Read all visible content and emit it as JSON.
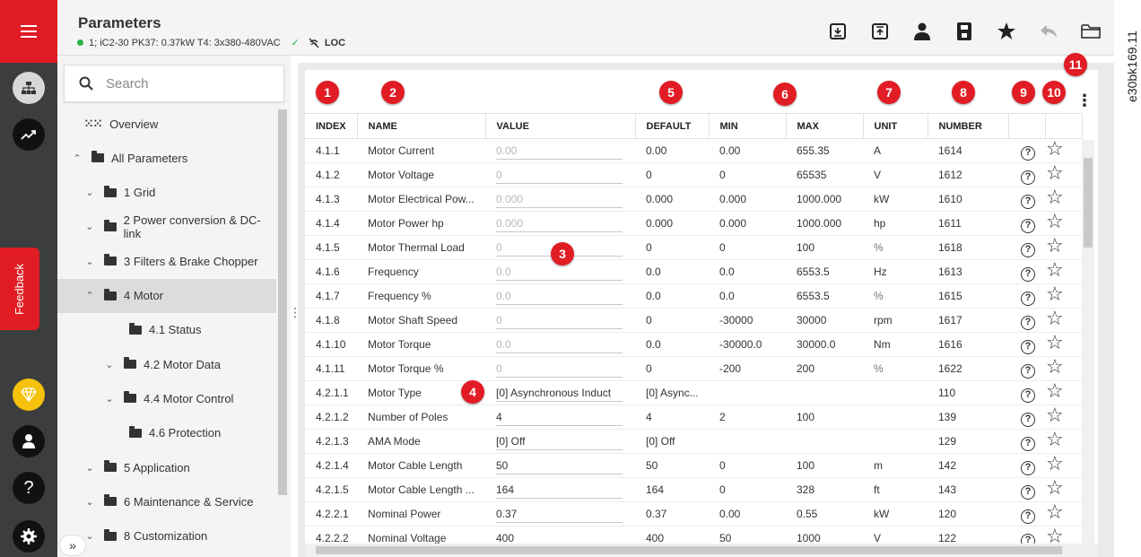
{
  "header": {
    "title": "Parameters",
    "status_text": "1; iC2-30 PK37: 0.37kW T4: 3x380-480VAC",
    "mode": "LOC"
  },
  "side_tag": "e30bk169.11",
  "rail": {
    "feedback_label": "Feedback",
    "help_glyph": "?"
  },
  "search": {
    "placeholder": "Search"
  },
  "tree": [
    {
      "label": "Overview",
      "chev": "",
      "indent": 0,
      "icon": "grid"
    },
    {
      "label": "All Parameters",
      "chev": "^",
      "indent": 0,
      "icon": "folder"
    },
    {
      "label": "1 Grid",
      "chev": "v",
      "indent": 1,
      "icon": "folder"
    },
    {
      "label": "2 Power conversion & DC-link",
      "chev": "v",
      "indent": 1,
      "icon": "folder"
    },
    {
      "label": "3 Filters & Brake Chopper",
      "chev": "v",
      "indent": 1,
      "icon": "folder"
    },
    {
      "label": "4 Motor",
      "chev": "^",
      "indent": 1,
      "icon": "folder",
      "active": true
    },
    {
      "label": "4.1 Status",
      "chev": "",
      "indent": 2,
      "icon": "folder"
    },
    {
      "label": "4.2 Motor Data",
      "chev": "v",
      "indent": 2,
      "icon": "folder"
    },
    {
      "label": "4.4 Motor Control",
      "chev": "v",
      "indent": 2,
      "icon": "folder"
    },
    {
      "label": "4.6 Protection",
      "chev": "",
      "indent": 2,
      "icon": "folder"
    },
    {
      "label": "5 Application",
      "chev": "v",
      "indent": 1,
      "icon": "folder"
    },
    {
      "label": "6 Maintenance & Service",
      "chev": "v",
      "indent": 1,
      "icon": "folder"
    },
    {
      "label": "8 Customization",
      "chev": "v",
      "indent": 1,
      "icon": "folder"
    }
  ],
  "columns": [
    "INDEX",
    "NAME",
    "VALUE",
    "DEFAULT",
    "MIN",
    "MAX",
    "UNIT",
    "NUMBER"
  ],
  "rows": [
    {
      "index": "4.1.1",
      "name": "Motor Current",
      "value": "0.00",
      "readonly": true,
      "default": "0.00",
      "min": "0.00",
      "max": "655.35",
      "unit": "A",
      "number": "1614"
    },
    {
      "index": "4.1.2",
      "name": "Motor Voltage",
      "value": "0",
      "readonly": true,
      "default": "0",
      "min": "0",
      "max": "65535",
      "unit": "V",
      "number": "1612"
    },
    {
      "index": "4.1.3",
      "name": "Motor Electrical Pow...",
      "value": "0.000",
      "readonly": true,
      "default": "0.000",
      "min": "0.000",
      "max": "1000.000",
      "unit": "kW",
      "number": "1610"
    },
    {
      "index": "4.1.4",
      "name": "Motor Power hp",
      "value": "0.000",
      "readonly": true,
      "default": "0.000",
      "min": "0.000",
      "max": "1000.000",
      "unit": "hp",
      "number": "1611"
    },
    {
      "index": "4.1.5",
      "name": "Motor Thermal Load",
      "value": "0",
      "readonly": true,
      "default": "0",
      "min": "0",
      "max": "100",
      "unit": "%",
      "number": "1618"
    },
    {
      "index": "4.1.6",
      "name": "Frequency",
      "value": "0.0",
      "readonly": true,
      "default": "0.0",
      "min": "0.0",
      "max": "6553.5",
      "unit": "Hz",
      "number": "1613"
    },
    {
      "index": "4.1.7",
      "name": "Frequency %",
      "value": "0.0",
      "readonly": true,
      "default": "0.0",
      "min": "0.0",
      "max": "6553.5",
      "unit": "%",
      "number": "1615"
    },
    {
      "index": "4.1.8",
      "name": "Motor Shaft Speed",
      "value": "0",
      "readonly": true,
      "default": "0",
      "min": "-30000",
      "max": "30000",
      "unit": "rpm",
      "number": "1617"
    },
    {
      "index": "4.1.10",
      "name": "Motor Torque",
      "value": "0.0",
      "readonly": true,
      "default": "0.0",
      "min": "-30000.0",
      "max": "30000.0",
      "unit": "Nm",
      "number": "1616"
    },
    {
      "index": "4.1.11",
      "name": "Motor Torque %",
      "value": "0",
      "readonly": true,
      "default": "0",
      "min": "-200",
      "max": "200",
      "unit": "%",
      "number": "1622"
    },
    {
      "index": "4.2.1.1",
      "name": "Motor Type",
      "value": "[0] Asynchronous Induct",
      "readonly": false,
      "default": "[0] Async...",
      "min": "",
      "max": "",
      "unit": "",
      "number": "110"
    },
    {
      "index": "4.2.1.2",
      "name": "Number of Poles",
      "value": "4",
      "readonly": false,
      "default": "4",
      "min": "2",
      "max": "100",
      "unit": "",
      "number": "139"
    },
    {
      "index": "4.2.1.3",
      "name": "AMA Mode",
      "value": "[0] Off",
      "readonly": false,
      "default": "[0] Off",
      "min": "",
      "max": "",
      "unit": "",
      "number": "129"
    },
    {
      "index": "4.2.1.4",
      "name": "Motor Cable Length",
      "value": "50",
      "readonly": false,
      "default": "50",
      "min": "0",
      "max": "100",
      "unit": "m",
      "number": "142"
    },
    {
      "index": "4.2.1.5",
      "name": "Motor Cable Length ...",
      "value": "164",
      "readonly": false,
      "default": "164",
      "min": "0",
      "max": "328",
      "unit": "ft",
      "number": "143"
    },
    {
      "index": "4.2.2.1",
      "name": "Nominal Power",
      "value": "0.37",
      "readonly": false,
      "default": "0.37",
      "min": "0.00",
      "max": "0.55",
      "unit": "kW",
      "number": "120"
    },
    {
      "index": "4.2.2.2",
      "name": "Nominal Voltage",
      "value": "400",
      "readonly": false,
      "default": "400",
      "min": "50",
      "max": "1000",
      "unit": "V",
      "number": "122"
    }
  ],
  "callouts": [
    "1",
    "2",
    "3",
    "4",
    "5",
    "6",
    "7",
    "8",
    "9",
    "10",
    "11"
  ],
  "colors": {
    "accent": "#e11c24",
    "rail": "#3b3d3e",
    "online": "#2ab34a"
  }
}
